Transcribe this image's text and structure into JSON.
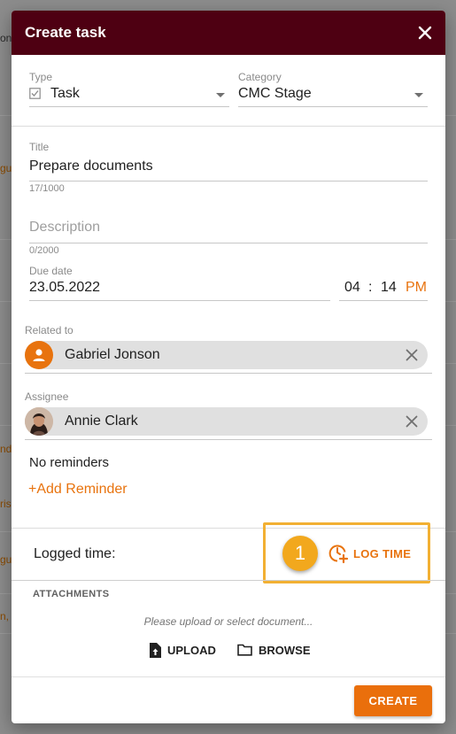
{
  "background": {
    "fragments": [
      "on",
      "gue",
      "nd",
      "ris",
      "gue",
      "n, C"
    ]
  },
  "dialog": {
    "title": "Create task",
    "type": {
      "label": "Type",
      "value": "Task"
    },
    "category": {
      "label": "Category",
      "value": "CMC Stage"
    },
    "title_field": {
      "label": "Title",
      "value": "Prepare documents",
      "counter": "17/1000"
    },
    "description": {
      "placeholder": "Description",
      "counter": "0/2000"
    },
    "due_date": {
      "label": "Due date",
      "value": "23.05.2022",
      "hour": "04",
      "separator": ":",
      "minute": "14",
      "ampm": "PM"
    },
    "related_to": {
      "label": "Related to",
      "name": "Gabriel Jonson"
    },
    "assignee": {
      "label": "Assignee",
      "name": "Annie Clark"
    },
    "reminders": {
      "status": "No reminders",
      "add_label": "+Add Reminder"
    },
    "logged_time": {
      "label": "Logged time:",
      "step_number": "1",
      "button_label": "LOG TIME"
    },
    "attachments": {
      "heading": "ATTACHMENTS",
      "hint": "Please upload or select document...",
      "upload_label": "UPLOAD",
      "browse_label": "BROWSE"
    },
    "create_label": "CREATE"
  },
  "colors": {
    "header": "#4e0012",
    "accent": "#e8730e",
    "highlight": "#f2b033",
    "chip": "#e0e0e0"
  }
}
